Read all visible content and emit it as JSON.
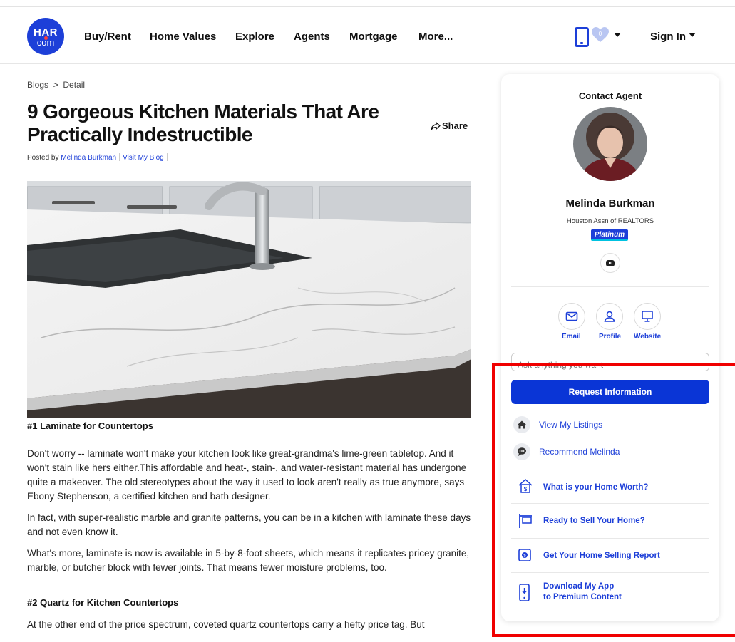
{
  "header": {
    "logo_top": "HAR",
    "logo_bottom": "com",
    "nav": [
      "Buy/Rent",
      "Home Values",
      "Explore",
      "Agents",
      "Mortgage",
      "More..."
    ],
    "favorites_count": "0",
    "sign_in": "Sign In",
    "brand_color": "#1d3fd8"
  },
  "article": {
    "breadcrumb": "Blogs  >  Detail",
    "title": "9 Gorgeous Kitchen Materials That Are Practically Indestructible",
    "share": "Share",
    "posted_by": "Posted by",
    "author": "Melinda Burkman",
    "visit_blog": "Visit My Blog",
    "section1_heading": "#1 Laminate for Countertops",
    "section1_paras": [
      "Don't worry -- laminate won't make your kitchen look like great-grandma's lime-green tabletop. And it won't stain like hers either.This affordable and heat-, stain-, and water-resistant material has undergone quite a makeover. The old stereotypes about the way it used to look aren't really as true anymore, says Ebony Stephenson, a certified kitchen and bath designer.",
      "In fact, with super-realistic marble and granite patterns, you can be in a kitchen with laminate these days and not even know it.",
      "What's more, laminate is now is available in 5-by-8-foot sheets, which means it replicates pricey granite, marble, or butcher block with fewer joints. That means fewer moisture problems, too."
    ],
    "section2_heading": "#2 Quartz for Kitchen Countertops",
    "section2_para": "At the other end of the price spectrum, coveted quartz countertops carry a hefty price tag. But"
  },
  "sidebar": {
    "title": "Contact Agent",
    "agent_name": "Melinda Burkman",
    "association": "Houston Assn of REALTORS",
    "badge": "Platinum",
    "actions": [
      "Email",
      "Profile",
      "Website"
    ],
    "ask_placeholder": "Ask anything you want",
    "request_button": "Request Information",
    "links": [
      "View My Listings",
      "Recommend Melinda"
    ],
    "blue_links": [
      "What is your Home Worth?",
      "Ready to Sell Your Home?",
      "Get Your Home Selling Report"
    ],
    "app_line1": "Download My App",
    "app_line2": "to Premium Content",
    "highlight_color": "#f00000"
  }
}
